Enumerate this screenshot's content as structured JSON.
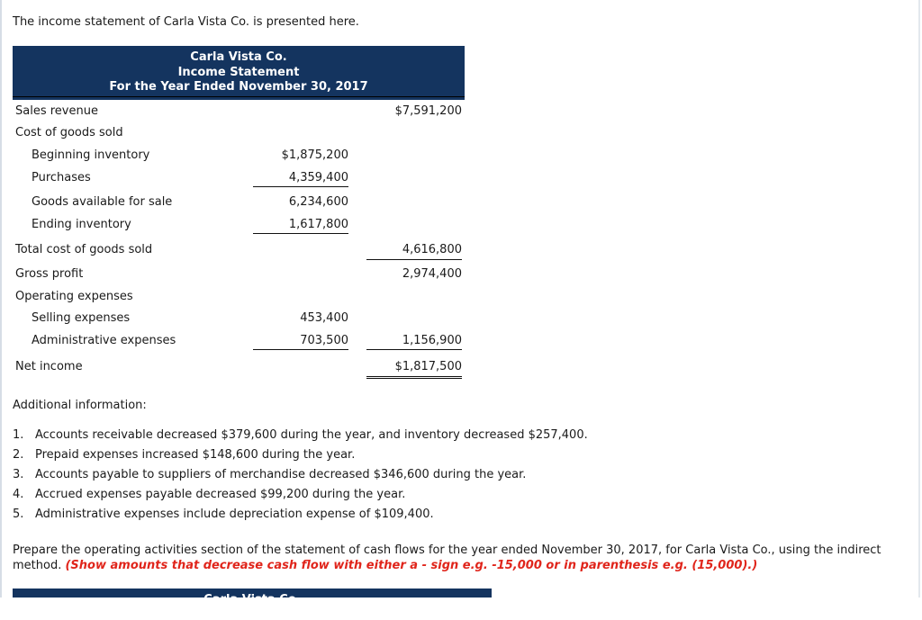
{
  "intro_text": "The income statement of Carla Vista Co. is presented here.",
  "income_statement": {
    "header": {
      "company": "Carla Vista Co.",
      "title": "Income Statement",
      "period": "For the Year Ended November 30, 2017"
    },
    "rows": [
      {
        "label": "Sales revenue",
        "indent": false,
        "mid": "",
        "right": "$7,591,200"
      },
      {
        "label": "Cost of goods sold",
        "indent": false,
        "mid": "",
        "right": ""
      },
      {
        "label": "Beginning inventory",
        "indent": true,
        "mid": "$1,875,200",
        "right": ""
      },
      {
        "label": "Purchases",
        "indent": true,
        "mid": "4,359,400",
        "right": ""
      },
      {
        "label": "Goods available for sale",
        "indent": true,
        "mid": "6,234,600",
        "right": ""
      },
      {
        "label": "Ending inventory",
        "indent": true,
        "mid": "1,617,800",
        "right": ""
      },
      {
        "label": "Total cost of goods sold",
        "indent": false,
        "mid": "",
        "right": "4,616,800"
      },
      {
        "label": "Gross profit",
        "indent": false,
        "mid": "",
        "right": "2,974,400"
      },
      {
        "label": "Operating expenses",
        "indent": false,
        "mid": "",
        "right": ""
      },
      {
        "label": "Selling expenses",
        "indent": true,
        "mid": "453,400",
        "right": ""
      },
      {
        "label": "Administrative expenses",
        "indent": true,
        "mid": "703,500",
        "right": "1,156,900"
      },
      {
        "label": "Net income",
        "indent": false,
        "mid": "",
        "right": "$1,817,500"
      }
    ]
  },
  "additional_info": {
    "title": "Additional information:",
    "items": [
      {
        "num": "1.",
        "text": "Accounts receivable decreased $379,600 during the year, and inventory decreased $257,400."
      },
      {
        "num": "2.",
        "text": "Prepaid expenses increased $148,600 during the year."
      },
      {
        "num": "3.",
        "text": "Accounts payable to suppliers of merchandise decreased $346,600 during the year."
      },
      {
        "num": "4.",
        "text": "Accrued expenses payable decreased $99,200 during the year."
      },
      {
        "num": "5.",
        "text": "Administrative expenses include depreciation expense of $109,400."
      }
    ]
  },
  "instructions": {
    "text": "Prepare the operating activities section of the statement of cash flows for the year ended November 30, 2017, for Carla Vista Co., using the indirect method.",
    "hint": "(Show amounts that decrease cash flow with either a - sign e.g. -15,000 or in parenthesis e.g. (15,000).)"
  },
  "cash_flow_header": {
    "company": "Carla Vista Co."
  },
  "colors": {
    "header_bg": "#14345f",
    "hint_red": "#e0251b"
  }
}
